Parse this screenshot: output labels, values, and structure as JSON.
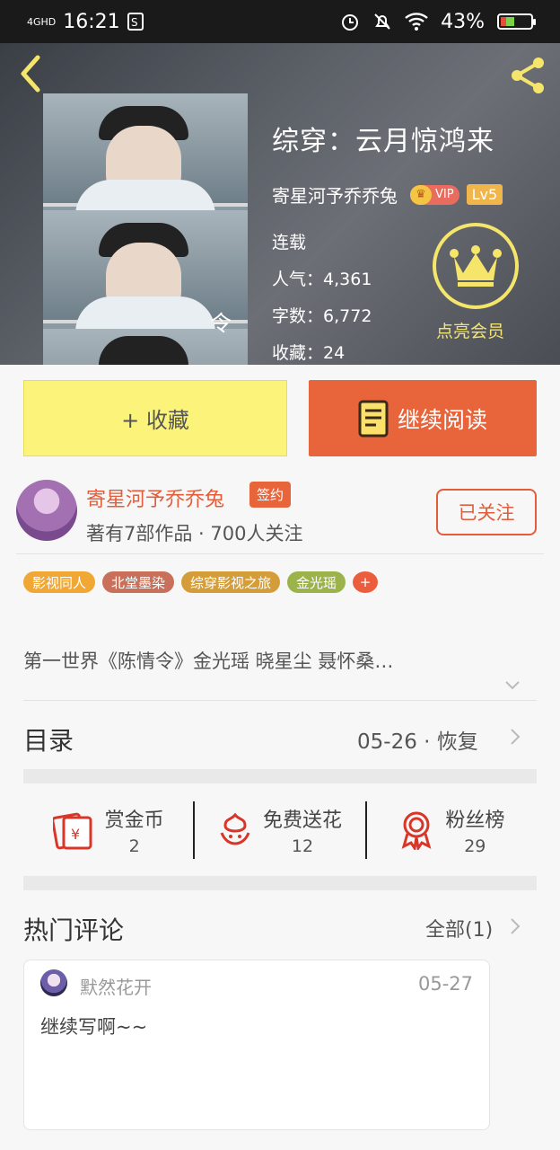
{
  "status_bar": {
    "network": "4GHD",
    "time": "16:21",
    "battery": "43%"
  },
  "book": {
    "title": "综穿：云月惊鸿来",
    "author": "寄星河予乔乔兔",
    "vip_badge": "VIP",
    "level": "Lv5",
    "status": "连载",
    "popularity_label": "人气：",
    "popularity": "4,361",
    "words_label": "字数：",
    "words": "6,772",
    "favorites_label": "收藏：",
    "favorites": "24",
    "member_label": "点亮会员"
  },
  "actions": {
    "favorite_label": "+ 收藏",
    "read_label": "继续阅读"
  },
  "author_card": {
    "name": "寄星河予乔乔兔",
    "signed_badge": "签约",
    "subtitle": "著有7部作品 · 700人关注",
    "follow_label": "已关注"
  },
  "tags": [
    {
      "label": "影视同人",
      "color": "#f0a734"
    },
    {
      "label": "北堂墨染",
      "color": "#c9705a"
    },
    {
      "label": "综穿影视之旅",
      "color": "#d49d3a"
    },
    {
      "label": "金光瑶",
      "color": "#9bb34a"
    }
  ],
  "summary": "第一世界《陈情令》金光瑶 晓星尘 聂怀桑…",
  "toc": {
    "label": "目录",
    "meta": "05-26 · 恢复"
  },
  "rewards": [
    {
      "name": "赏金币",
      "count": "2",
      "icon": "red-envelope-icon"
    },
    {
      "name": "免费送花",
      "count": "12",
      "icon": "flower-icon"
    },
    {
      "name": "粉丝榜",
      "count": "29",
      "icon": "medal-icon"
    }
  ],
  "hot_comments": {
    "label": "热门评论",
    "all_label": "全部(1)",
    "items": [
      {
        "user": "默然花开",
        "date": "05-27",
        "text": "继续写啊~~"
      }
    ]
  },
  "colors": {
    "accent": "#e8643a",
    "favorite_bg": "#fbf37a",
    "gold": "#f5e66b"
  }
}
